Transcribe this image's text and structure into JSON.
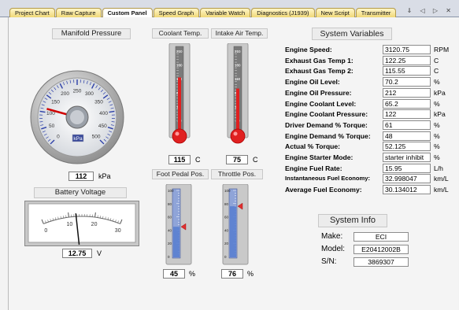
{
  "tabs": [
    {
      "label": "Project Chart"
    },
    {
      "label": "Raw Capture"
    },
    {
      "label": "Custom Panel"
    },
    {
      "label": "Speed Graph"
    },
    {
      "label": "Variable Watch"
    },
    {
      "label": "Diagnostics (J1939)"
    },
    {
      "label": "New Script"
    },
    {
      "label": "Transmitter"
    }
  ],
  "tab_controls": "⇓ ◁ ▷ ✕",
  "manifold": {
    "title": "Manifold Pressure",
    "value": "112",
    "unit": "kPa",
    "dial_unit": "kPa",
    "dial_level": 112,
    "dial_max": 500,
    "ticks": [
      "0",
      "50",
      "100",
      "150",
      "200",
      "250",
      "300",
      "350",
      "400",
      "450",
      "500"
    ]
  },
  "battery": {
    "title": "Battery Voltage",
    "value": "12.75",
    "unit": "V",
    "meter_level": 12.75,
    "meter_max": 30,
    "ticks": [
      "0",
      "10",
      "20",
      "30"
    ]
  },
  "coolant": {
    "title": "Coolant Temp.",
    "value": "115",
    "unit": "C",
    "level": 115,
    "max": 210,
    "ticks": [
      "210",
      "160",
      "110",
      "60",
      "10",
      "-40"
    ]
  },
  "intake": {
    "title": "Intake Air Temp.",
    "value": "75",
    "unit": "C",
    "level": 75,
    "max": 210,
    "ticks": [
      "210",
      "160",
      "110",
      "60",
      "10",
      "-40"
    ]
  },
  "pedal": {
    "title": "Foot Pedal Pos.",
    "value": "45",
    "unit": "%",
    "level": 45,
    "ticks": [
      "100",
      "80",
      "60",
      "40",
      "20",
      "0"
    ]
  },
  "throttle": {
    "title": "Throttle Pos.",
    "value": "76",
    "unit": "%",
    "level": 76,
    "ticks": [
      "100",
      "80",
      "60",
      "40",
      "20",
      "0"
    ]
  },
  "system_variables": {
    "title": "System Variables",
    "rows": [
      {
        "label": "Engine Speed:",
        "value": "3120.75",
        "unit": "RPM"
      },
      {
        "label": "Exhaust Gas Temp 1:",
        "value": "122.25",
        "unit": "C"
      },
      {
        "label": "Exhaust Gas Temp 2:",
        "value": "115.55",
        "unit": "C"
      },
      {
        "label": "Engine Oil Level:",
        "value": "70.2",
        "unit": "%"
      },
      {
        "label": "Engine Oil Pressure:",
        "value": "212",
        "unit": "kPa"
      },
      {
        "label": "Engine Coolant Level:",
        "value": "65.2",
        "unit": "%"
      },
      {
        "label": "Engine Coolant Pressure:",
        "value": "122",
        "unit": "kPa"
      },
      {
        "label": "Driver Demand % Torque:",
        "value": "61",
        "unit": "%"
      },
      {
        "label": "Engine Demand % Torque:",
        "value": "48",
        "unit": "%"
      },
      {
        "label": "Actual % Torque:",
        "value": "52.125",
        "unit": "%"
      },
      {
        "label": "Engine Starter Mode:",
        "value": "starter inhibit",
        "unit": "%"
      },
      {
        "label": "Engine Fuel Rate:",
        "value": "15.95",
        "unit": "L/h"
      },
      {
        "label": "Instantaneous Fuel Economy:",
        "value": "32.998047",
        "unit": "km/L"
      },
      {
        "label": "Average Fuel Economy:",
        "value": "30.134012",
        "unit": "km/L"
      }
    ]
  },
  "system_info": {
    "title": "System Info",
    "make_label": "Make:",
    "make": "ECI",
    "model_label": "Model:",
    "model": "E20412002B",
    "sn_label": "S/N:",
    "sn": "3869307"
  },
  "colors": {
    "tab_bg": "#f0d878",
    "mercury": "#e02020",
    "bar_fill": "#5a7fd0",
    "gauge_needle": "#d00000"
  }
}
